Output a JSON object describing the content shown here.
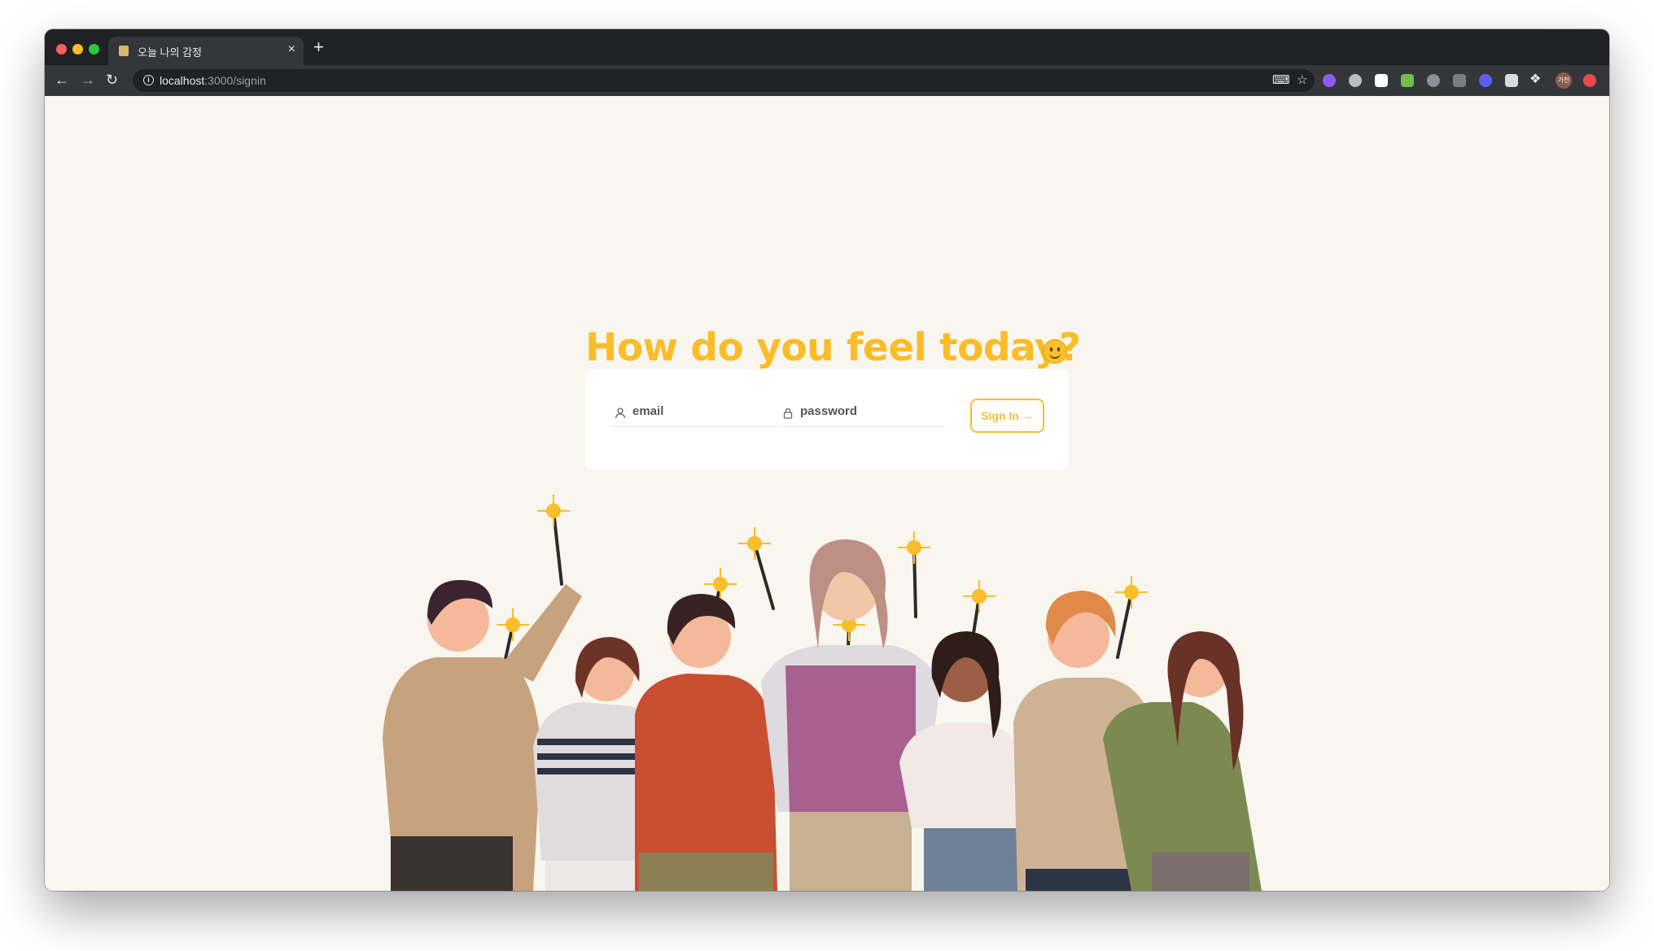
{
  "browser": {
    "tab_title": "오늘 나의 감정",
    "tab_close": "×",
    "new_tab": "+",
    "url_host": "localhost",
    "url_path": ":3000/signin"
  },
  "page": {
    "headline": "How do you feel today?",
    "headline_emoji": "slightly-smiling-face",
    "email_placeholder": "email",
    "password_placeholder": "password",
    "signin_label": "Sign In →",
    "accent_color": "#fbbc29",
    "background_color": "#f9f6ef"
  },
  "icons": [
    "back-arrow-icon",
    "forward-arrow-icon",
    "reload-icon",
    "info-icon",
    "translate-icon",
    "star-icon",
    "extensions-icon",
    "profile-avatar",
    "user-icon",
    "lock-icon"
  ],
  "extensions": {
    "profile_text": "가천"
  }
}
